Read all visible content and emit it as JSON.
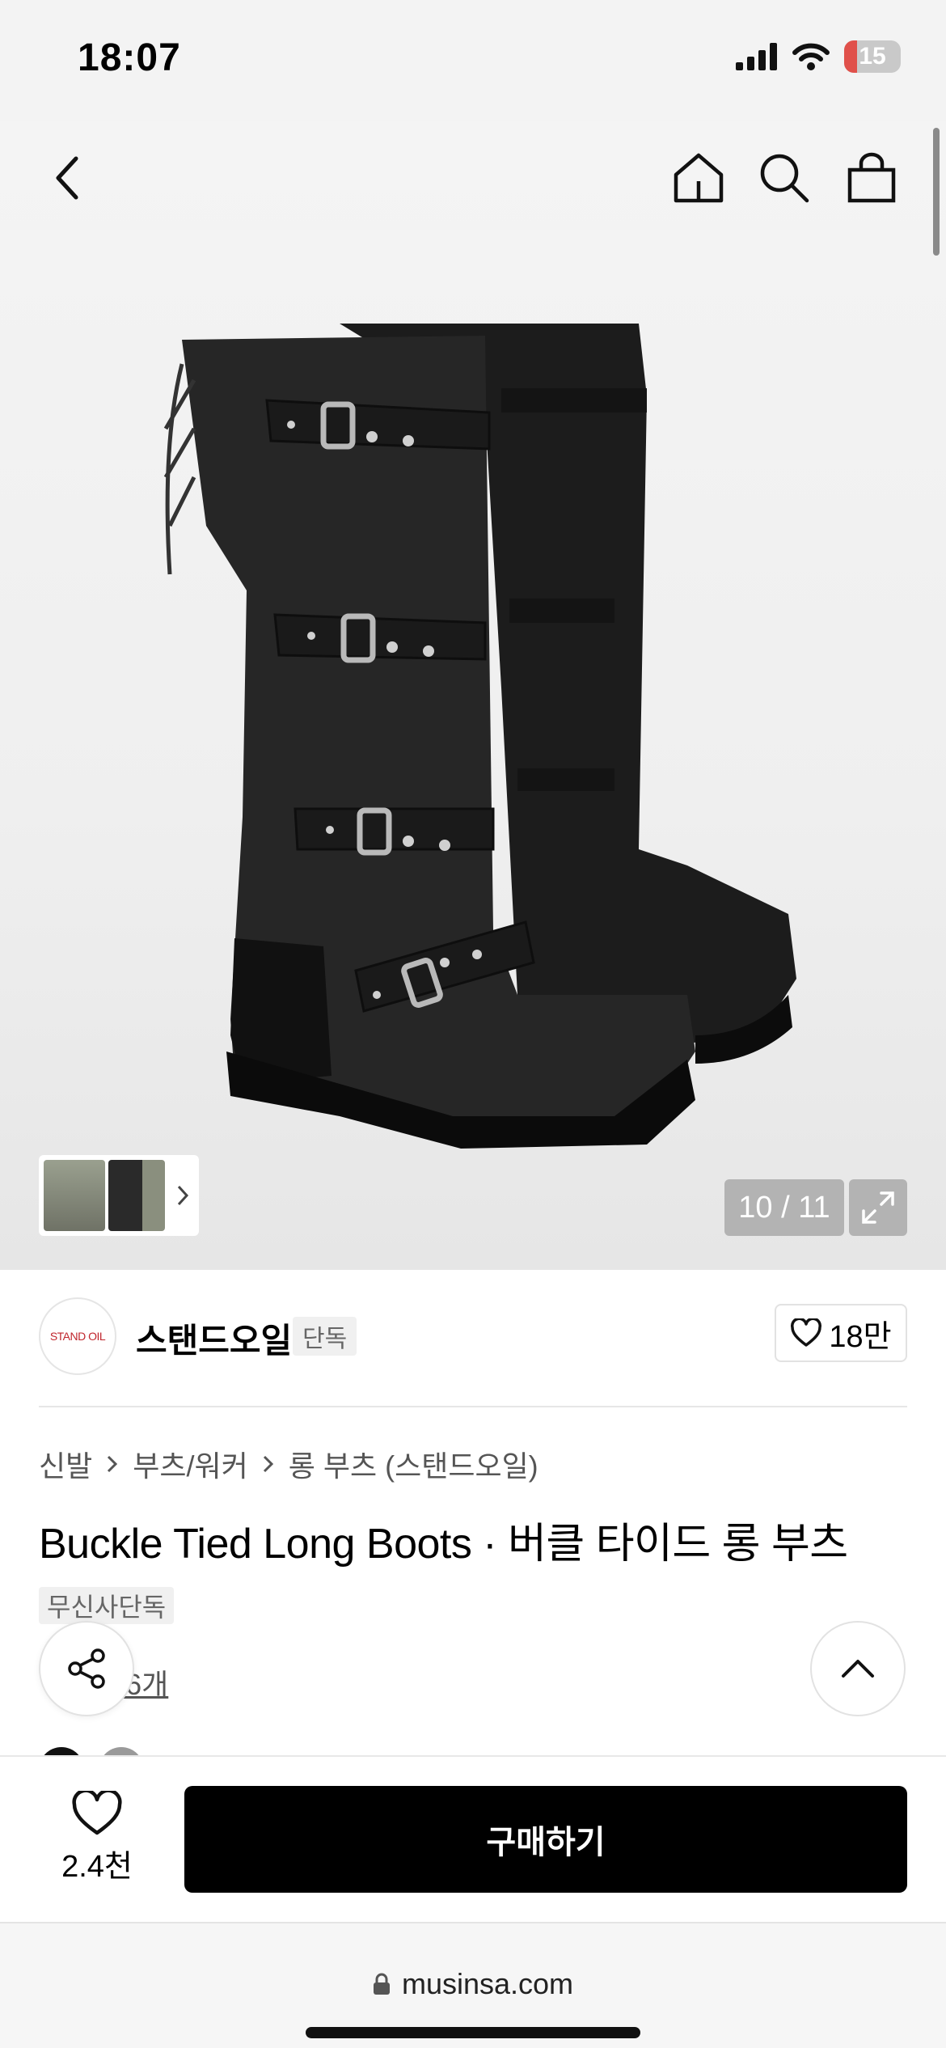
{
  "status_bar": {
    "time": "18:07",
    "battery": "15",
    "icons": [
      "signal-icon",
      "wifi-icon",
      "battery-icon"
    ]
  },
  "nav": {
    "icons": [
      "back-arrow-icon",
      "home-icon",
      "search-icon",
      "shopping-bag-icon"
    ]
  },
  "gallery": {
    "counter": "10 / 11",
    "current": 10,
    "total": 11,
    "expand_icon": "expand-icon",
    "thumbs_icon": "chevron-right-icon"
  },
  "brand": {
    "logo_text": "STAND OIL",
    "name": "스탠드오일",
    "badge": "단독",
    "likes": "18만"
  },
  "breadcrumb": [
    "신발",
    "부츠/워커",
    "롱 부츠 (스탠드오일)"
  ],
  "product": {
    "title": "Buckle Tied Long Boots · 버클 타이드 롱 부츠",
    "tag": "무신사단독",
    "review_link": "후기 6개",
    "review_visible": "기 6개"
  },
  "buy_bar": {
    "wish_count": "2.4천",
    "buy_label": "구매하기"
  },
  "browser": {
    "url": "musinsa.com"
  },
  "colors": {
    "accent": "#000000",
    "brand_logo": "#c0262d",
    "battery_low": "#e0504a"
  }
}
